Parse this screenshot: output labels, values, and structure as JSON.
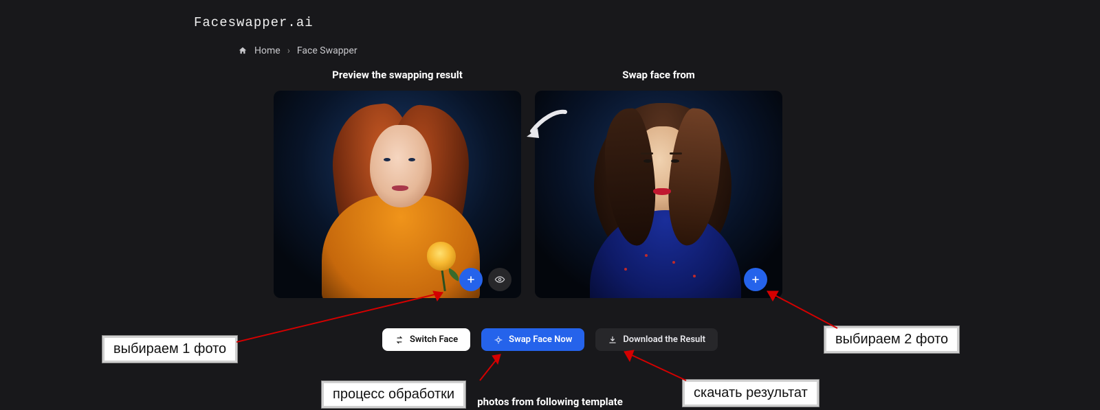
{
  "logo": "Faceswapper.ai",
  "breadcrumb": {
    "home": "Home",
    "current": "Face Swapper"
  },
  "panels": {
    "left_title": "Preview the swapping result",
    "right_title": "Swap face from"
  },
  "buttons": {
    "switch_face": "Switch Face",
    "swap_now": "Swap Face Now",
    "download": "Download the Result"
  },
  "template_line": "photos from following template",
  "annotations": {
    "select1": "выбираем 1 фото",
    "select2": "выбираем 2 фото",
    "process": "процесс обработки",
    "download": "скачать результат"
  },
  "icons": {
    "plus": "plus-icon",
    "eye": "eye-icon",
    "home": "home-icon",
    "arrow_left": "arrow-left-icon",
    "switch": "switch-icon",
    "magic": "magic-icon",
    "download": "download-icon"
  }
}
